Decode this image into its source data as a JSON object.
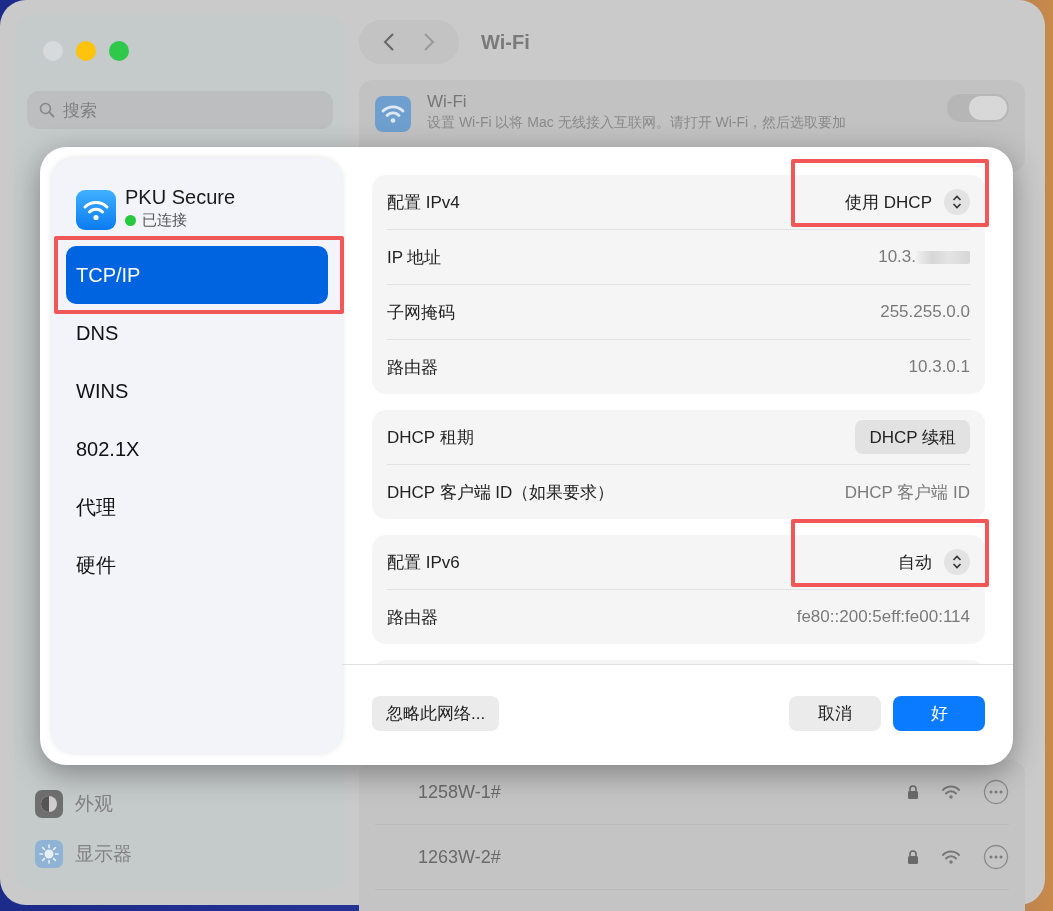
{
  "window": {
    "title": "Wi-Fi",
    "search": {
      "placeholder": "搜索"
    },
    "sidebar_items": [
      {
        "label": "外观",
        "kind": "appearance"
      },
      {
        "label": "显示器",
        "kind": "display"
      }
    ],
    "wifi_card": {
      "title": "Wi-Fi",
      "description": "设置 Wi-Fi 以将 Mac 无线接入互联网。请打开 Wi-Fi，然后选取要加",
      "on": false
    },
    "networks": [
      {
        "name": "1258W-1#",
        "locked": true
      },
      {
        "name": "1263W-2#",
        "locked": true
      }
    ]
  },
  "sheet": {
    "network": {
      "name": "PKU Secure",
      "status": "已连接",
      "color": "#28c840"
    },
    "tabs": [
      {
        "label": "TCP/IP",
        "selected": true,
        "highlighted": true
      },
      {
        "label": "DNS",
        "selected": false,
        "highlighted": false
      },
      {
        "label": "WINS",
        "selected": false,
        "highlighted": false
      },
      {
        "label": "802.1X",
        "selected": false,
        "highlighted": false
      },
      {
        "label": "代理",
        "selected": false,
        "highlighted": false
      },
      {
        "label": "硬件",
        "selected": false,
        "highlighted": false
      }
    ],
    "sections": [
      {
        "rows": [
          {
            "label": "配置 IPv4",
            "kind": "popup",
            "value": "使用 DHCP",
            "highlighted": true
          },
          {
            "label": "IP 地址",
            "kind": "text",
            "value": "10.3.",
            "redacted": true
          },
          {
            "label": "子网掩码",
            "kind": "text",
            "value": "255.255.0.0"
          },
          {
            "label": "路由器",
            "kind": "text",
            "value": "10.3.0.1"
          }
        ]
      },
      {
        "rows": [
          {
            "label": "DHCP 租期",
            "kind": "button",
            "value": "DHCP 续租"
          },
          {
            "label": "DHCP 客户端 ID（如果要求）",
            "kind": "text",
            "value": "DHCP 客户端 ID"
          }
        ]
      },
      {
        "rows": [
          {
            "label": "配置 IPv6",
            "kind": "popup",
            "value": "自动",
            "highlighted": true
          },
          {
            "label": "路由器",
            "kind": "text",
            "value": "fe80::200:5eff:fe00:114"
          }
        ]
      }
    ],
    "buttons": [
      {
        "label": "忽略此网络...",
        "kind": "secondary"
      },
      {
        "label": "取消",
        "kind": "secondary"
      },
      {
        "label": "好",
        "kind": "primary"
      }
    ]
  }
}
